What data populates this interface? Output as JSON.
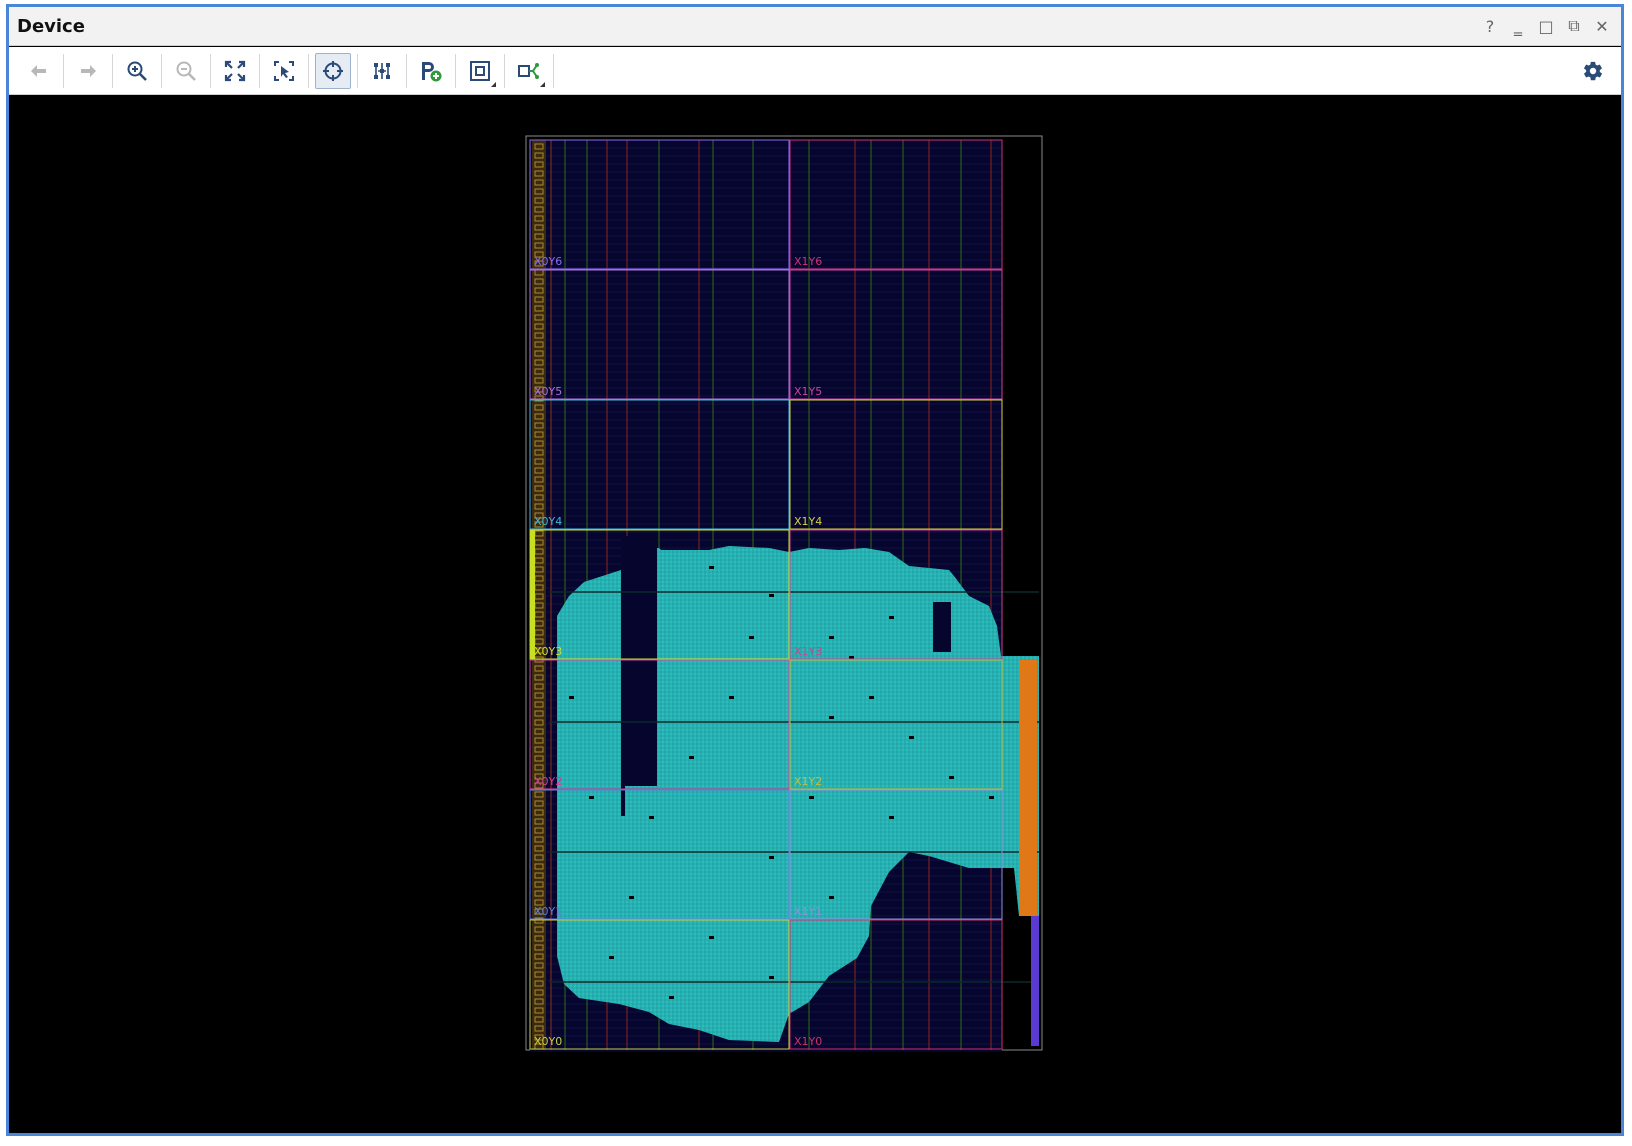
{
  "window": {
    "title": "Device",
    "controls": [
      {
        "name": "help-icon",
        "glyph": "?"
      },
      {
        "name": "minimize-icon",
        "glyph": "‗"
      },
      {
        "name": "maximize-icon",
        "glyph": "□"
      },
      {
        "name": "restore-icon",
        "glyph": "⧉"
      },
      {
        "name": "close-icon",
        "glyph": "✕"
      }
    ]
  },
  "toolbar": {
    "buttons": [
      {
        "name": "back-icon",
        "enabled": false
      },
      {
        "name": "forward-icon",
        "enabled": false
      },
      {
        "name": "zoom-in-icon",
        "enabled": true
      },
      {
        "name": "zoom-out-icon",
        "enabled": false
      },
      {
        "name": "zoom-fit-icon",
        "enabled": true
      },
      {
        "name": "zoom-selection-icon",
        "enabled": true
      },
      {
        "name": "auto-fit-selection-icon",
        "enabled": true,
        "active": true
      },
      {
        "name": "routing-resources-icon",
        "enabled": true
      },
      {
        "name": "create-pblock-icon",
        "enabled": true
      },
      {
        "name": "cell-view-icon",
        "enabled": true,
        "dropdown": true
      },
      {
        "name": "show-connections-icon",
        "enabled": true,
        "dropdown": true
      }
    ],
    "settings_icon": "gear-icon"
  },
  "colors": {
    "accent": "#4a86d8",
    "device_bg": "#05052e",
    "placement_fill": "#2bbcbc",
    "placement_grid": "#1e8f94"
  },
  "device": {
    "clock_regions": [
      {
        "label": "X0Y6",
        "color": "#8a6cf0"
      },
      {
        "label": "X1Y6",
        "color": "#d0307a"
      },
      {
        "label": "X0Y5",
        "color": "#b070d8"
      },
      {
        "label": "X1Y5",
        "color": "#d040a0"
      },
      {
        "label": "X0Y4",
        "color": "#40b8d8"
      },
      {
        "label": "X1Y4",
        "color": "#d8d040"
      },
      {
        "label": "X0Y3",
        "color": "#c8e030"
      },
      {
        "label": "X1Y3",
        "color": "#d04090"
      },
      {
        "label": "X0Y2",
        "color": "#d0409a"
      },
      {
        "label": "X1Y2",
        "color": "#c0c040"
      },
      {
        "label": "X0Y1",
        "color": "#6080d8"
      },
      {
        "label": "X1Y1",
        "color": "#9090d8"
      },
      {
        "label": "X0Y0",
        "color": "#c8d040"
      },
      {
        "label": "X1Y0",
        "color": "#d0306a"
      }
    ]
  }
}
